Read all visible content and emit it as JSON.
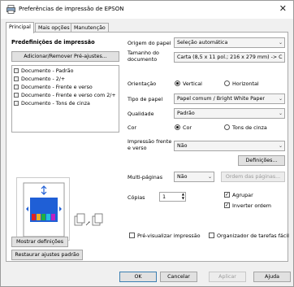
{
  "window": {
    "title": "Preferências de impressão de EPSON",
    "close_glyph": "✕"
  },
  "tabs": [
    {
      "label": "Principal",
      "active": true
    },
    {
      "label": "Mais opções",
      "active": false
    },
    {
      "label": "Manutenção",
      "active": false
    }
  ],
  "presets": {
    "heading": "Predefinições de impressão",
    "add_remove_button": "Adicionar/Remover Pré-ajustes...",
    "items": [
      "Documento - Padrão",
      "Documento - 2/+",
      "Documento - Frente e verso",
      "Documento - Frente e verso com 2/+",
      "Documento - Tons de cinza"
    ]
  },
  "left_buttons": {
    "show_settings": "Mostrar definições",
    "restore_defaults": "Restaurar ajustes padrão"
  },
  "settings": {
    "paper_source": {
      "label": "Origem do papel",
      "value": "Seleção automática"
    },
    "document_size": {
      "label": "Tamanho do documento",
      "value": "Carta (8,5 x 11 pol.; 216 x 279 mm) -> C"
    },
    "orientation": {
      "label": "Orientação",
      "options": [
        "Vertical",
        "Horizontal"
      ],
      "selected": "Vertical"
    },
    "paper_type": {
      "label": "Tipo de papel",
      "value": "Papel comum / Bright White Paper"
    },
    "quality": {
      "label": "Qualidade",
      "value": "Padrão"
    },
    "color": {
      "label": "Cor",
      "options": [
        "Cor",
        "Tons de cinza"
      ],
      "selected": "Cor"
    },
    "duplex": {
      "label": "Impressão frente e verso",
      "value": "Não",
      "definitions_button": "Definições..."
    },
    "multipage": {
      "label": "Multi-páginas",
      "value": "Não",
      "page_order_button": "Ordem das páginas..."
    },
    "copies": {
      "label": "Cópias",
      "value": "1",
      "collate_label": "Agrupar",
      "collate": true,
      "reverse_label": "Inverter ordem",
      "reverse": true
    },
    "preview": {
      "label": "Pré-visualizar impressão",
      "checked": false
    },
    "job_arranger": {
      "label": "Organizador de tarefas fácil",
      "checked": false
    }
  },
  "footer": {
    "ok": "OK",
    "cancel": "Cancelar",
    "apply": "Aplicar",
    "help": "Ajuda"
  },
  "colors": {
    "accent": "#3c7fb1",
    "preview_blue": "#1f5fd6"
  }
}
